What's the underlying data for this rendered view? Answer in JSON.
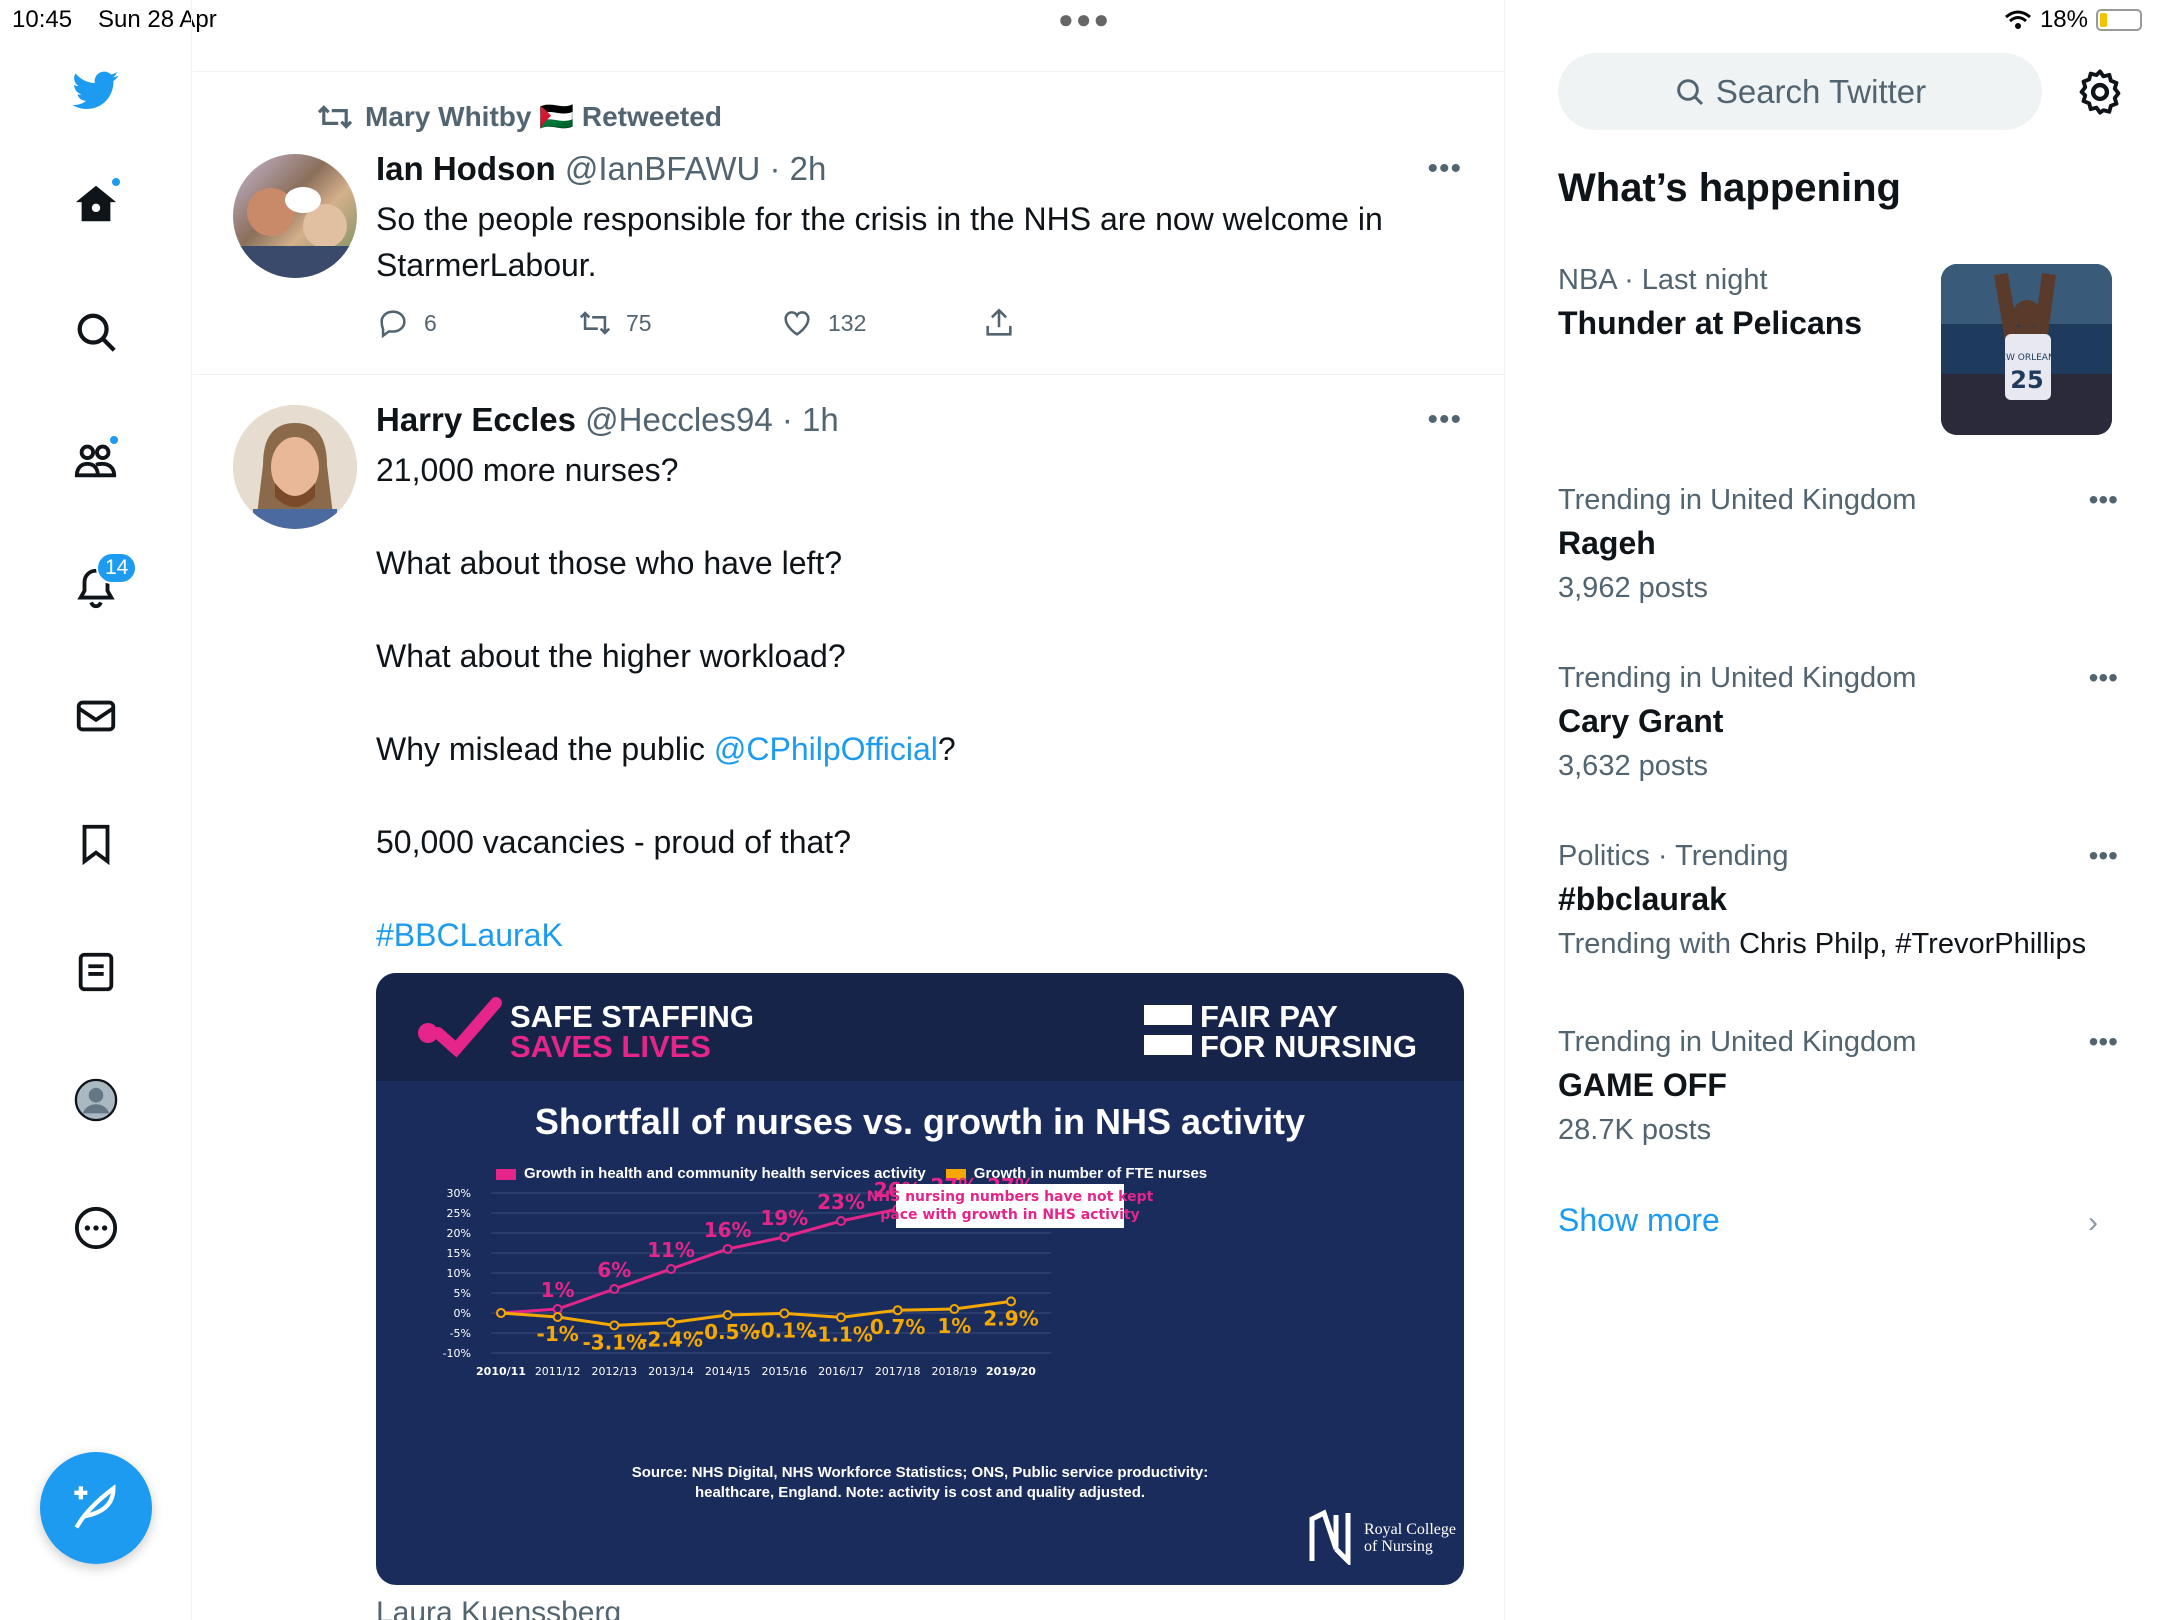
{
  "status_bar": {
    "time": "10:45",
    "date": "Sun 28 Apr",
    "battery": "18%",
    "battery_level": 0.18
  },
  "nav": {
    "notifications_count": "14",
    "brand_color": "#1d9bf0"
  },
  "timeline": {
    "tweet1": {
      "retweeted_by": "Mary Whitby 🇵🇸 Retweeted",
      "name": "Ian Hodson",
      "handle_time": "@IanBFAWU · 2h",
      "text": "So the people responsible for the crisis in the NHS are now welcome in StarmerLabour.",
      "replies": "6",
      "retweets": "75",
      "likes": "132"
    },
    "tweet2": {
      "name": "Harry Eccles",
      "handle_time": "@Heccles94 · 1h",
      "line1": "21,000 more nurses?",
      "line2": "What about those who have left?",
      "line3": "What about the higher workload?",
      "line4_prefix": "Why mislead the public ",
      "line4_mention": "@CPhilpOfficial",
      "line4_suffix": "?",
      "line5": "50,000 vacancies - proud of that?",
      "hashtag": "#BBCLauraK",
      "below": "Laura Kuenssberg"
    },
    "infographic": {
      "banner_left_1": "SAFE STAFFING",
      "banner_left_2": "SAVES LIVES",
      "banner_right_1": "FAIR PAY",
      "banner_right_2": "FOR NURSING",
      "source": "Source: NHS Digital, NHS Workforce Statistics; ONS, Public service productivity:",
      "source2": "healthcare, England. Note: activity is cost and quality adjusted.",
      "org_1": "Royal College",
      "org_2": "of Nursing",
      "callout_1": "NHS nursing numbers have not kept",
      "callout_2": "pace with growth in NHS activity"
    }
  },
  "chart_data": {
    "type": "line",
    "title": "Shortfall of nurses vs. growth in NHS activity",
    "x": [
      "2010/11",
      "2011/12",
      "2012/13",
      "2013/14",
      "2014/15",
      "2015/16",
      "2016/17",
      "2017/18",
      "2018/19",
      "2019/20"
    ],
    "ylim": [
      -10,
      30
    ],
    "yticks": [
      "30%",
      "25%",
      "20%",
      "15%",
      "10%",
      "5%",
      "0%",
      "-5%",
      "-10%"
    ],
    "series": [
      {
        "name": "Growth in health and community health services activity",
        "color": "#e5258a",
        "values": [
          0,
          1,
          6,
          11,
          16,
          19,
          23,
          26,
          27,
          27
        ],
        "labels": [
          "",
          "1%",
          "6%",
          "11%",
          "16%",
          "19%",
          "23%",
          "26%",
          "27%",
          "27%"
        ]
      },
      {
        "name": "Growth in number of FTE nurses",
        "color": "#f5a800",
        "values": [
          0,
          -1,
          -3.1,
          -2.4,
          -0.5,
          -0.1,
          -1.1,
          0.7,
          1,
          2.9
        ],
        "labels": [
          "",
          "-1%",
          "-3.1%",
          "-2.4%",
          "-0.5%",
          "-0.1%",
          "-1.1%",
          "0.7%",
          "1%",
          "2.9%"
        ]
      }
    ]
  },
  "sidebar": {
    "search_placeholder": "Search Twitter",
    "title": "What’s happening",
    "trends": [
      {
        "category": "NBA · Last night",
        "name": "Thunder at Pelicans"
      },
      {
        "category": "Trending in United Kingdom",
        "name": "Rageh",
        "count": "3,962 posts"
      },
      {
        "category": "Trending in United Kingdom",
        "name": "Cary Grant",
        "count": "3,632 posts"
      },
      {
        "category": "Politics · Trending",
        "name": "#bbclaurak",
        "with_label": "Trending with ",
        "with_names": "Chris Philp, #TrevorPhillips"
      },
      {
        "category": "Trending in United Kingdom",
        "name": "GAME OFF",
        "count": "28.7K posts"
      }
    ],
    "nba_jersey": "25",
    "nba_team": "NEW ORLEANS",
    "show_more": "Show more"
  }
}
